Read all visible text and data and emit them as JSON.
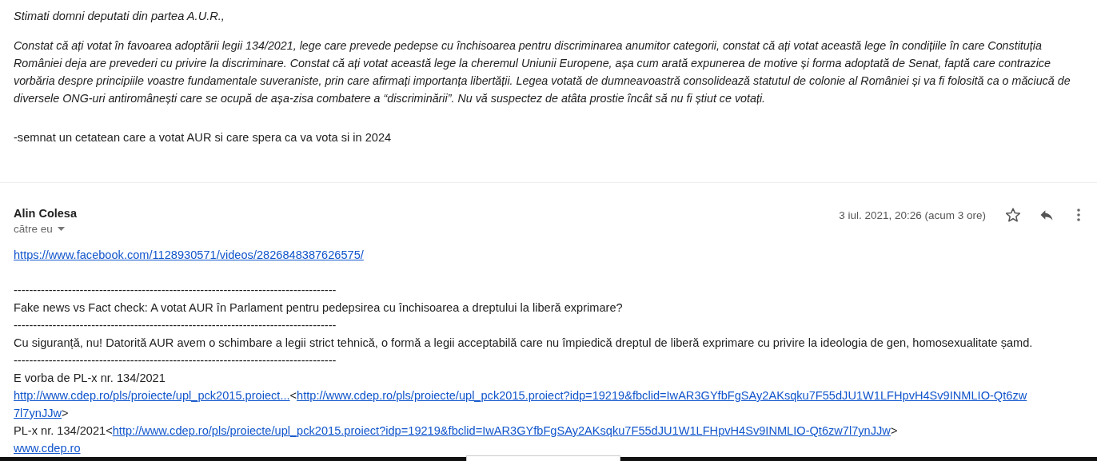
{
  "previous_message": {
    "greeting": "Stimati domni deputati din partea A.U.R.,",
    "paragraph": "Constat că ați votat în favoarea adoptării legii 134/2021, lege care prevede pedepse cu închisoarea pentru discriminarea anumitor categorii, constat că ați votat această lege în condițiile în care Constituția României deja are prevederi cu privire la discriminare. Constat că ați votat această lege la cheremul Uniunii Europene, așa cum arată expunerea de motive și forma adoptată de Senat, faptă care contrazice vorbăria despre principiile voastre fundamentale suveraniste, prin care afirmați importanța libertății. Legea votată de dumneavoastră consolidează statutul de colonie al României și va fi folosită ca o măciucă de diversele ONG-uri antiromânești care se ocupă de așa-zisa combatere a “discriminării”. Nu vă suspectez de atâta prostie încât să nu fi știut ce votați.",
    "signature": "-semnat un cetatean care a votat AUR si care spera ca va vota si in 2024"
  },
  "message": {
    "sender": "Alin Colesa",
    "recipient": "către eu",
    "date": "3 iul. 2021, 20:26 (acum 3 ore)",
    "starred": false,
    "body": [
      {
        "kind": "link",
        "text": "https://www.facebook.com/1128930571/videos/2826848387626575/"
      },
      {
        "kind": "gap"
      },
      {
        "kind": "text",
        "text": "-----------------------------------------------------------------------------------"
      },
      {
        "kind": "text",
        "text": "Fake news vs Fact check: A votat AUR în Parlament pentru pedepsirea cu închisoarea a dreptului la liberă exprimare?"
      },
      {
        "kind": "text",
        "text": "-----------------------------------------------------------------------------------"
      },
      {
        "kind": "text",
        "text": "Cu siguranță, nu! Datorită AUR avem o schimbare a legii strict tehnică, o formă a legii acceptabilă care nu împiedică dreptul de liberă exprimare cu privire la ideologia de gen, homosexualitate șamd."
      },
      {
        "kind": "text",
        "text": "-----------------------------------------------------------------------------------"
      },
      {
        "kind": "text",
        "text": "E vorba de PL-x nr. 134/2021"
      },
      {
        "kind": "mixed",
        "parts": [
          {
            "kind": "link",
            "text": "http://www.cdep.ro/pls/proiecte/upl_pck2015.proiect..."
          },
          {
            "kind": "text",
            "text": "<"
          },
          {
            "kind": "link",
            "text": "http://www.cdep.ro/pls/proiecte/upl_pck2015.proiect?idp=19219&fbclid=IwAR3GYfbFgSAy2AKsqku7F55dJU1W1LFHpvH4Sv9INMLIO-Qt6zw"
          }
        ]
      },
      {
        "kind": "mixed",
        "parts": [
          {
            "kind": "link",
            "text": "7l7ynJJw"
          },
          {
            "kind": "text",
            "text": ">"
          }
        ]
      },
      {
        "kind": "mixed",
        "parts": [
          {
            "kind": "text",
            "text": "PL-x nr. 134/2021<"
          },
          {
            "kind": "link",
            "text": "http://www.cdep.ro/pls/proiecte/upl_pck2015.proiect?idp=19219&fbclid=IwAR3GYfbFgSAy2AKsqku7F55dJU1W1LFHpvH4Sv9INMLIO-Qt6zw7l7ynJJw"
          },
          {
            "kind": "text",
            "text": ">"
          }
        ]
      },
      {
        "kind": "link",
        "text": "www.cdep.ro"
      }
    ]
  }
}
